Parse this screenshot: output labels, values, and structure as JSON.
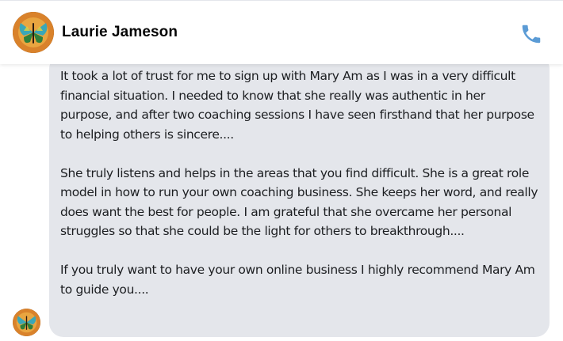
{
  "header": {
    "contact_name": "Laurie Jameson",
    "call_icon": "phone-icon"
  },
  "colors": {
    "bubble_background": "#e4e6eb",
    "text": "#1c1e21",
    "accent": "#5b9bd5"
  },
  "message": {
    "paragraphs": [
      "It took a lot of trust for me to sign up with Mary Am as I was in a very difficult financial situation. I needed to know that she really was authentic in her purpose, and after two coaching sessions I have seen firsthand that her purpose to helping others is sincere....",
      "She truly listens and helps in the areas that you find difficult. She is a great role model in how to run your own coaching business. She keeps her word, and really does want the best for people. I am grateful that she overcame her personal struggles so that she could be the light for others to breakthrough....",
      "If you truly want to have your own online business I highly recommend Mary Am to guide you...."
    ]
  }
}
